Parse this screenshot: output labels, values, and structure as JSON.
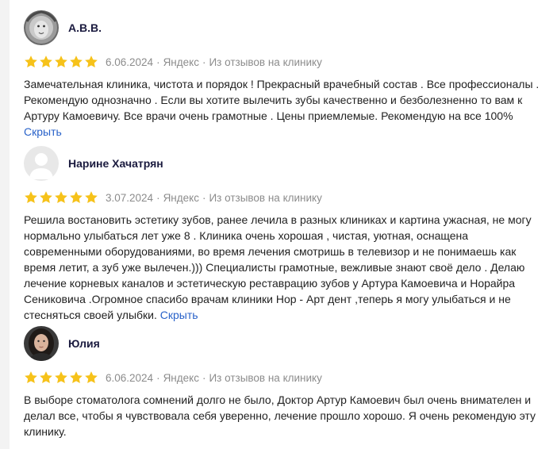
{
  "reviews": [
    {
      "author": "А.В.В.",
      "rating": 5,
      "date": "6.06.2024",
      "source": "Яндекс",
      "origin": "Из отзывов на клинику",
      "text": "Замечательная клиника, чистота и порядок ! Прекрасный врачебный состав . Все профессионалы . Рекомендую однозначно . Если вы хотите вылечить зубы качественно и безболезненно то вам к Артуру Камоевичу. Все врачи очень грамотные . Цены приемлемые. Рекомендую на все 100%",
      "hide_label": "Скрыть",
      "avatar_icon": "lion-photo-avatar"
    },
    {
      "author": "Нарине Хачатрян",
      "rating": 5,
      "date": "3.07.2024",
      "source": "Яндекс",
      "origin": "Из отзывов на клинику",
      "text": "Решила востановить эстетику зубов, ранее лечила в разных клиниках и картина ужасная, не могу нормально улыбаться лет уже 8 . Клиника очень хорошая , чистая, уютная, оснащена современными оборудованиями, во время лечения смотришь в телевизор и не понимаешь как время летит, а зуб уже вылечен.))) Специалисты грамотные, вежливые знают своё дело . Делаю лечение корневых каналов и эстетическую реставрацию зубов у Артура Камоевича и Норайра Сениковича .Огромное спасибо врачам клиники Нор - Арт дент ,теперь я могу улыбаться и не стесняться своей улыбки.",
      "hide_label": "Скрыть",
      "avatar_icon": "default-user-avatar"
    },
    {
      "author": "Юлия",
      "rating": 5,
      "date": "6.06.2024",
      "source": "Яндекс",
      "origin": "Из отзывов на клинику",
      "text": "В выборе стоматолога сомнений долго не было, Доктор Артур Камоевич был очень внимателен и делал все, чтобы я чувствовала себя уверенно, лечение прошло хорошо. Я очень рекомендую эту клинику.",
      "hide_label": "",
      "avatar_icon": "woman-photo-avatar"
    }
  ],
  "colors": {
    "star": "#f6c21a",
    "author": "#1b1b3f",
    "meta": "#8c8c8c",
    "link": "#2962c9"
  }
}
